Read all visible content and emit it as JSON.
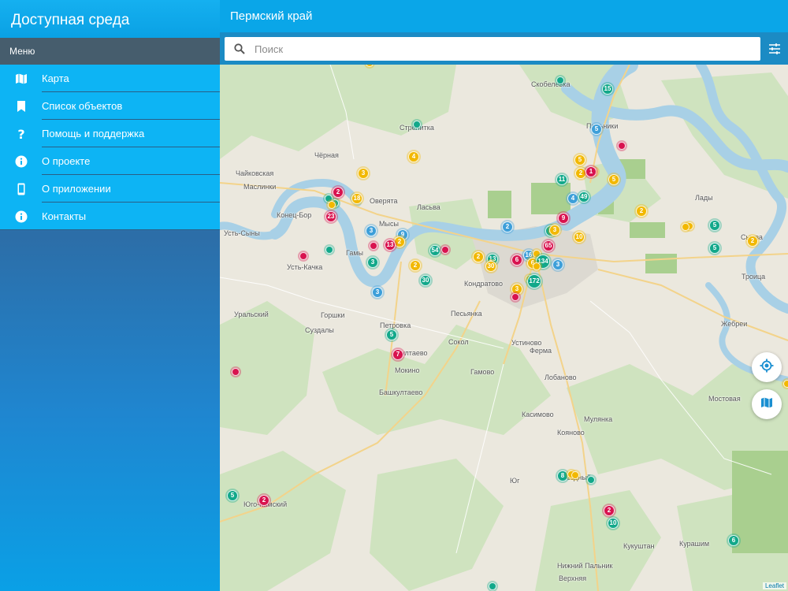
{
  "app": {
    "title": "Доступная среда"
  },
  "menu": {
    "header": "Меню",
    "items": [
      {
        "label": "Карта",
        "icon": "map-icon"
      },
      {
        "label": "Список объектов",
        "icon": "bookmark-icon"
      },
      {
        "label": "Помощь и поддержка",
        "icon": "question-icon"
      },
      {
        "label": "О проекте",
        "icon": "info-icon"
      },
      {
        "label": "О приложении",
        "icon": "phone-icon"
      },
      {
        "label": "Контакты",
        "icon": "info-icon"
      }
    ]
  },
  "header": {
    "title": "Пермский край"
  },
  "search": {
    "placeholder": "Поиск",
    "value": ""
  },
  "map": {
    "attribution": "Leaflet",
    "places": [
      "Скобелевка",
      "Пальники",
      "Стрелитка",
      "Чёрная",
      "Чайковская",
      "Маслинки",
      "Конец-Бор",
      "Усть-Сыны",
      "Оверята",
      "Ласьва",
      "Мысы",
      "Гамы",
      "Усть-Качка",
      "Уральский",
      "Горшки",
      "Суздалы",
      "Петровка",
      "Култаево",
      "Мокино",
      "Кондратово",
      "Песьянка",
      "Сокол",
      "Устиново",
      "Гамово",
      "Ферма",
      "Лобаново",
      "Башкултаево",
      "Касимово",
      "Мулянка",
      "Кояново",
      "Юг",
      "Звёздный",
      "Юго-Камский",
      "Кукуштан",
      "Курашим",
      "Нижний Пальник",
      "Верхняя",
      "Мостовая",
      "Жебреи",
      "Троица",
      "Сылва",
      "Лады"
    ],
    "markers": [
      {
        "c": "yellow",
        "n": ""
      },
      {
        "c": "green",
        "n": ""
      },
      {
        "c": "green",
        "n": "15"
      },
      {
        "c": "blue",
        "n": "5"
      },
      {
        "c": "red",
        "n": ""
      },
      {
        "c": "green",
        "n": ""
      },
      {
        "c": "yellow",
        "n": "4"
      },
      {
        "c": "yellow",
        "n": "3"
      },
      {
        "c": "yellow",
        "n": ""
      },
      {
        "c": "yellow",
        "n": "5"
      },
      {
        "c": "yellow",
        "n": "2"
      },
      {
        "c": "red",
        "n": "1"
      },
      {
        "c": "yellow",
        "n": ""
      },
      {
        "c": "green",
        "n": "11"
      },
      {
        "c": "yellow",
        "n": "5"
      },
      {
        "c": "blue",
        "n": "4"
      },
      {
        "c": "green",
        "n": "49"
      },
      {
        "c": "red",
        "n": "2"
      },
      {
        "c": "green",
        "n": ""
      },
      {
        "c": "yellow",
        "n": "18"
      },
      {
        "c": "green",
        "n": ""
      },
      {
        "c": "yellow",
        "n": ""
      },
      {
        "c": "red",
        "n": "23"
      },
      {
        "c": "red",
        "n": "9"
      },
      {
        "c": "yellow",
        "n": "2"
      },
      {
        "c": "yellow",
        "n": ""
      },
      {
        "c": "yellow",
        "n": ""
      },
      {
        "c": "green",
        "n": "5"
      },
      {
        "c": "green",
        "n": "2"
      },
      {
        "c": "yellow",
        "n": "3"
      },
      {
        "c": "yellow",
        "n": "10"
      },
      {
        "c": "blue",
        "n": "2"
      },
      {
        "c": "blue",
        "n": "3"
      },
      {
        "c": "blue",
        "n": "9"
      },
      {
        "c": "yellow",
        "n": "2"
      },
      {
        "c": "red",
        "n": "13"
      },
      {
        "c": "red",
        "n": ""
      },
      {
        "c": "green",
        "n": "54"
      },
      {
        "c": "red",
        "n": ""
      },
      {
        "c": "red",
        "n": "65"
      },
      {
        "c": "yellow",
        "n": "2"
      },
      {
        "c": "green",
        "n": "13"
      },
      {
        "c": "yellow",
        "n": "30"
      },
      {
        "c": "red",
        "n": "6"
      },
      {
        "c": "blue",
        "n": "16"
      },
      {
        "c": "yellow",
        "n": ""
      },
      {
        "c": "yellow",
        "n": "6"
      },
      {
        "c": "green",
        "n": "134"
      },
      {
        "c": "yellow",
        "n": ""
      },
      {
        "c": "blue",
        "n": "3"
      },
      {
        "c": "yellow",
        "n": ""
      },
      {
        "c": "green",
        "n": "172"
      },
      {
        "c": "yellow",
        "n": "3"
      },
      {
        "c": "red",
        "n": ""
      },
      {
        "c": "green",
        "n": "5"
      },
      {
        "c": "yellow",
        "n": "2"
      },
      {
        "c": "green",
        "n": "3"
      },
      {
        "c": "yellow",
        "n": "2"
      },
      {
        "c": "green",
        "n": "30"
      },
      {
        "c": "green",
        "n": ""
      },
      {
        "c": "red",
        "n": ""
      },
      {
        "c": "blue",
        "n": "3"
      },
      {
        "c": "green",
        "n": "5"
      },
      {
        "c": "red",
        "n": "7"
      },
      {
        "c": "red",
        "n": ""
      },
      {
        "c": "green",
        "n": "8"
      },
      {
        "c": "yellow",
        "n": ""
      },
      {
        "c": "yellow",
        "n": ""
      },
      {
        "c": "green",
        "n": ""
      },
      {
        "c": "red",
        "n": "2"
      },
      {
        "c": "green",
        "n": "10"
      },
      {
        "c": "green",
        "n": "5"
      },
      {
        "c": "red",
        "n": "2"
      },
      {
        "c": "green",
        "n": "6"
      },
      {
        "c": "green",
        "n": ""
      },
      {
        "c": "yellow",
        "n": ""
      }
    ]
  }
}
